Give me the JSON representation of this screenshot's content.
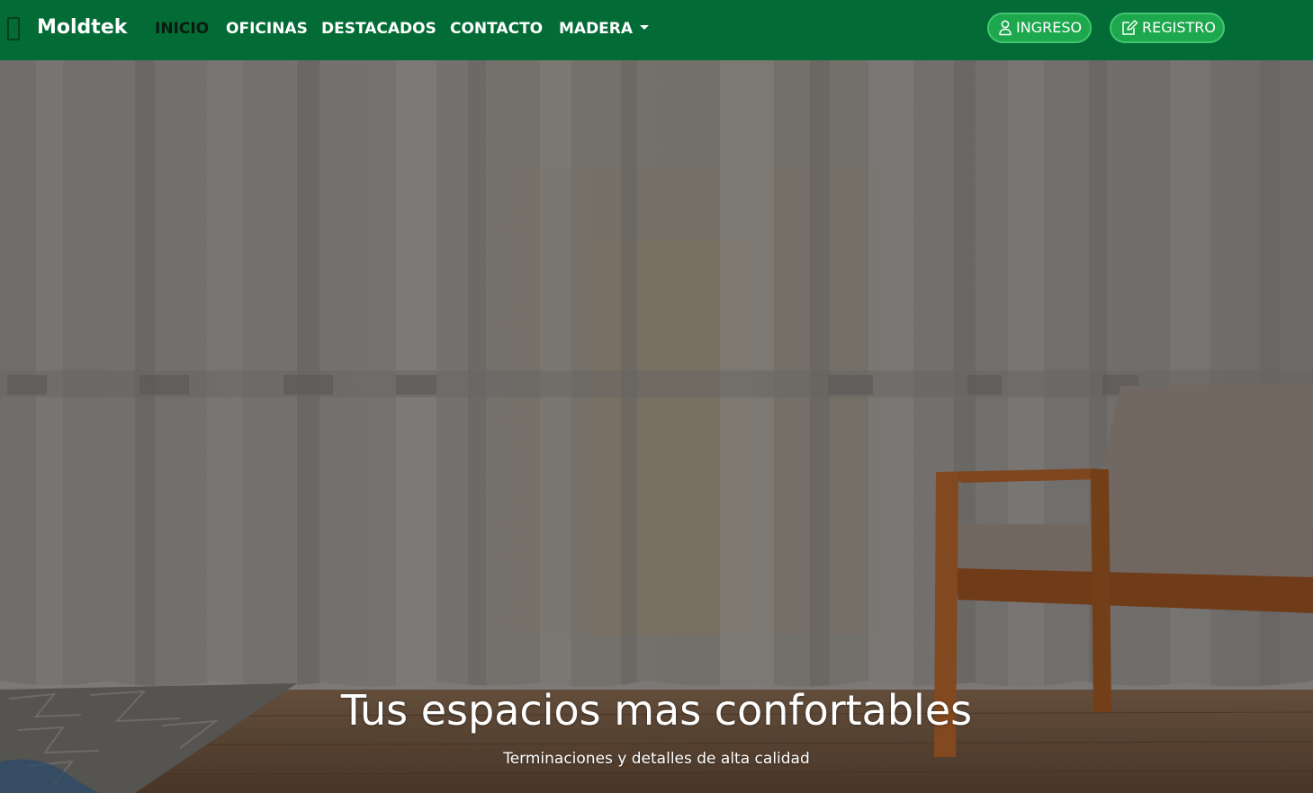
{
  "navbar": {
    "brand": "Moldtek",
    "links": [
      {
        "label": "INICIO",
        "active": true
      },
      {
        "label": "OFICINAS",
        "active": false
      },
      {
        "label": "DESTACADOS",
        "active": false
      },
      {
        "label": "CONTACTO",
        "active": false
      },
      {
        "label": "MADERA",
        "active": false,
        "dropdown": true
      }
    ],
    "buttons": {
      "login": {
        "label": "INGRESO",
        "icon": "person-icon"
      },
      "register": {
        "label": "REGISTRO",
        "icon": "edit-icon"
      }
    },
    "colors": {
      "background": "#036b35",
      "button": "#1ea84e",
      "active_link": "#0b1a10"
    }
  },
  "hero": {
    "title": "Tus espacios mas confortables",
    "subtitle": "Terminaciones y detalles de alta calidad",
    "background": "sheer white curtains with a wooden armchair on a wood floor and a patterned rug"
  }
}
